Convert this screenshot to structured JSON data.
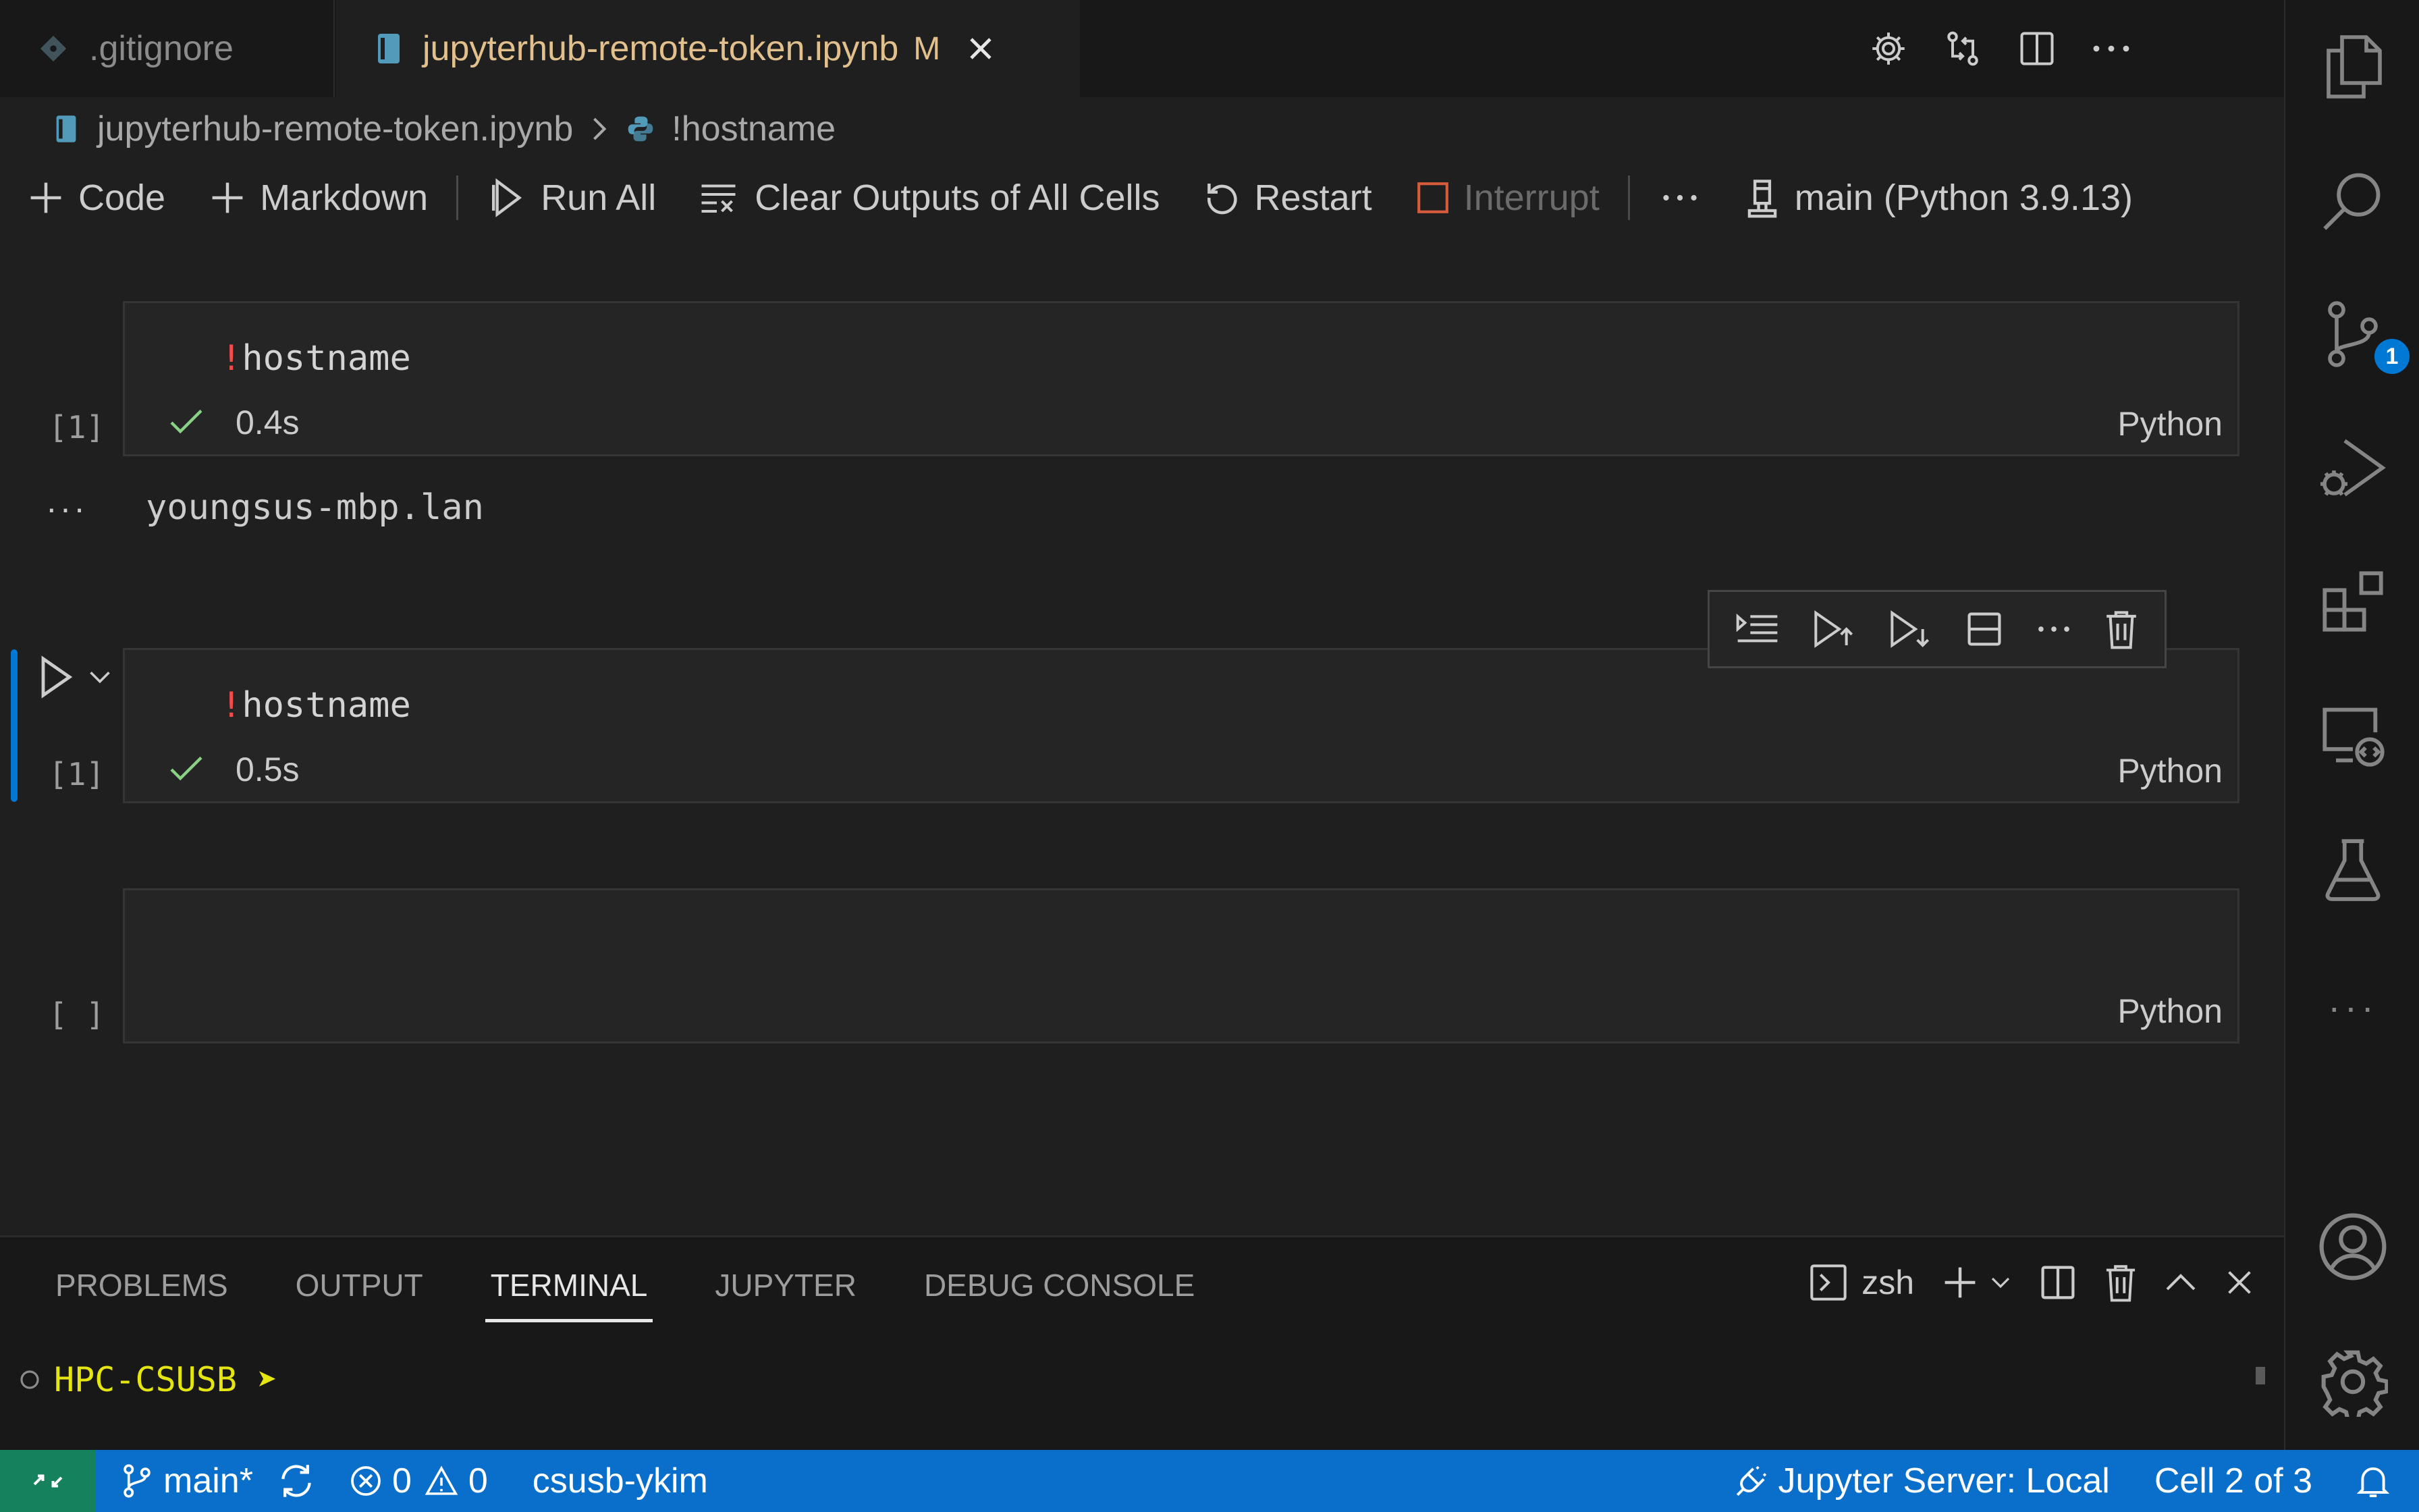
{
  "tabs": [
    {
      "label": ".gitignore",
      "icon": "git-diamond-icon",
      "active": false
    },
    {
      "label": "jupyterhub-remote-token.ipynb",
      "icon": "notebook-icon",
      "active": true,
      "modified_marker": "M"
    }
  ],
  "breadcrumb": {
    "file": "jupyterhub-remote-token.ipynb",
    "separator": ">",
    "symbol": "!hostname"
  },
  "toolbar": {
    "code_label": "Code",
    "markdown_label": "Markdown",
    "run_all_label": "Run All",
    "clear_outputs_label": "Clear Outputs of All Cells",
    "restart_label": "Restart",
    "interrupt_label": "Interrupt",
    "more_label": "···",
    "kernel_label": "main (Python 3.9.13)"
  },
  "cells": [
    {
      "bang": "!",
      "code": "hostname",
      "exec_count": "[1]",
      "time": "0.4s",
      "language": "Python"
    },
    {
      "bang": "!",
      "code": "hostname",
      "exec_count": "[1]",
      "time": "0.5s",
      "language": "Python"
    },
    {
      "bang": "",
      "code": "",
      "exec_count": "[ ]",
      "time": "",
      "language": "Python"
    }
  ],
  "output": {
    "more": "···",
    "text": "youngsus-mbp.lan"
  },
  "panel": {
    "tabs": [
      "PROBLEMS",
      "OUTPUT",
      "TERMINAL",
      "JUPYTER",
      "DEBUG CONSOLE"
    ],
    "active_tab": "TERMINAL",
    "shell_label": "zsh",
    "terminal_prompt": "HPC-CSUSB ➤"
  },
  "activity": {
    "scm_badge": "1",
    "more": "···"
  },
  "statusbar": {
    "branch": "main*",
    "errors": "0",
    "warnings": "0",
    "account": "csusb-ykim",
    "jupyter_server": "Jupyter Server: Local",
    "cell_position": "Cell 2 of 3"
  },
  "colors": {
    "accent": "#0078d4",
    "statusbar": "#0a6ecb",
    "remote": "#16825d",
    "modified": "#e2c08d",
    "success": "#89d185",
    "error_bang": "#f14c4c",
    "terminal_prompt": "#e5e510"
  }
}
